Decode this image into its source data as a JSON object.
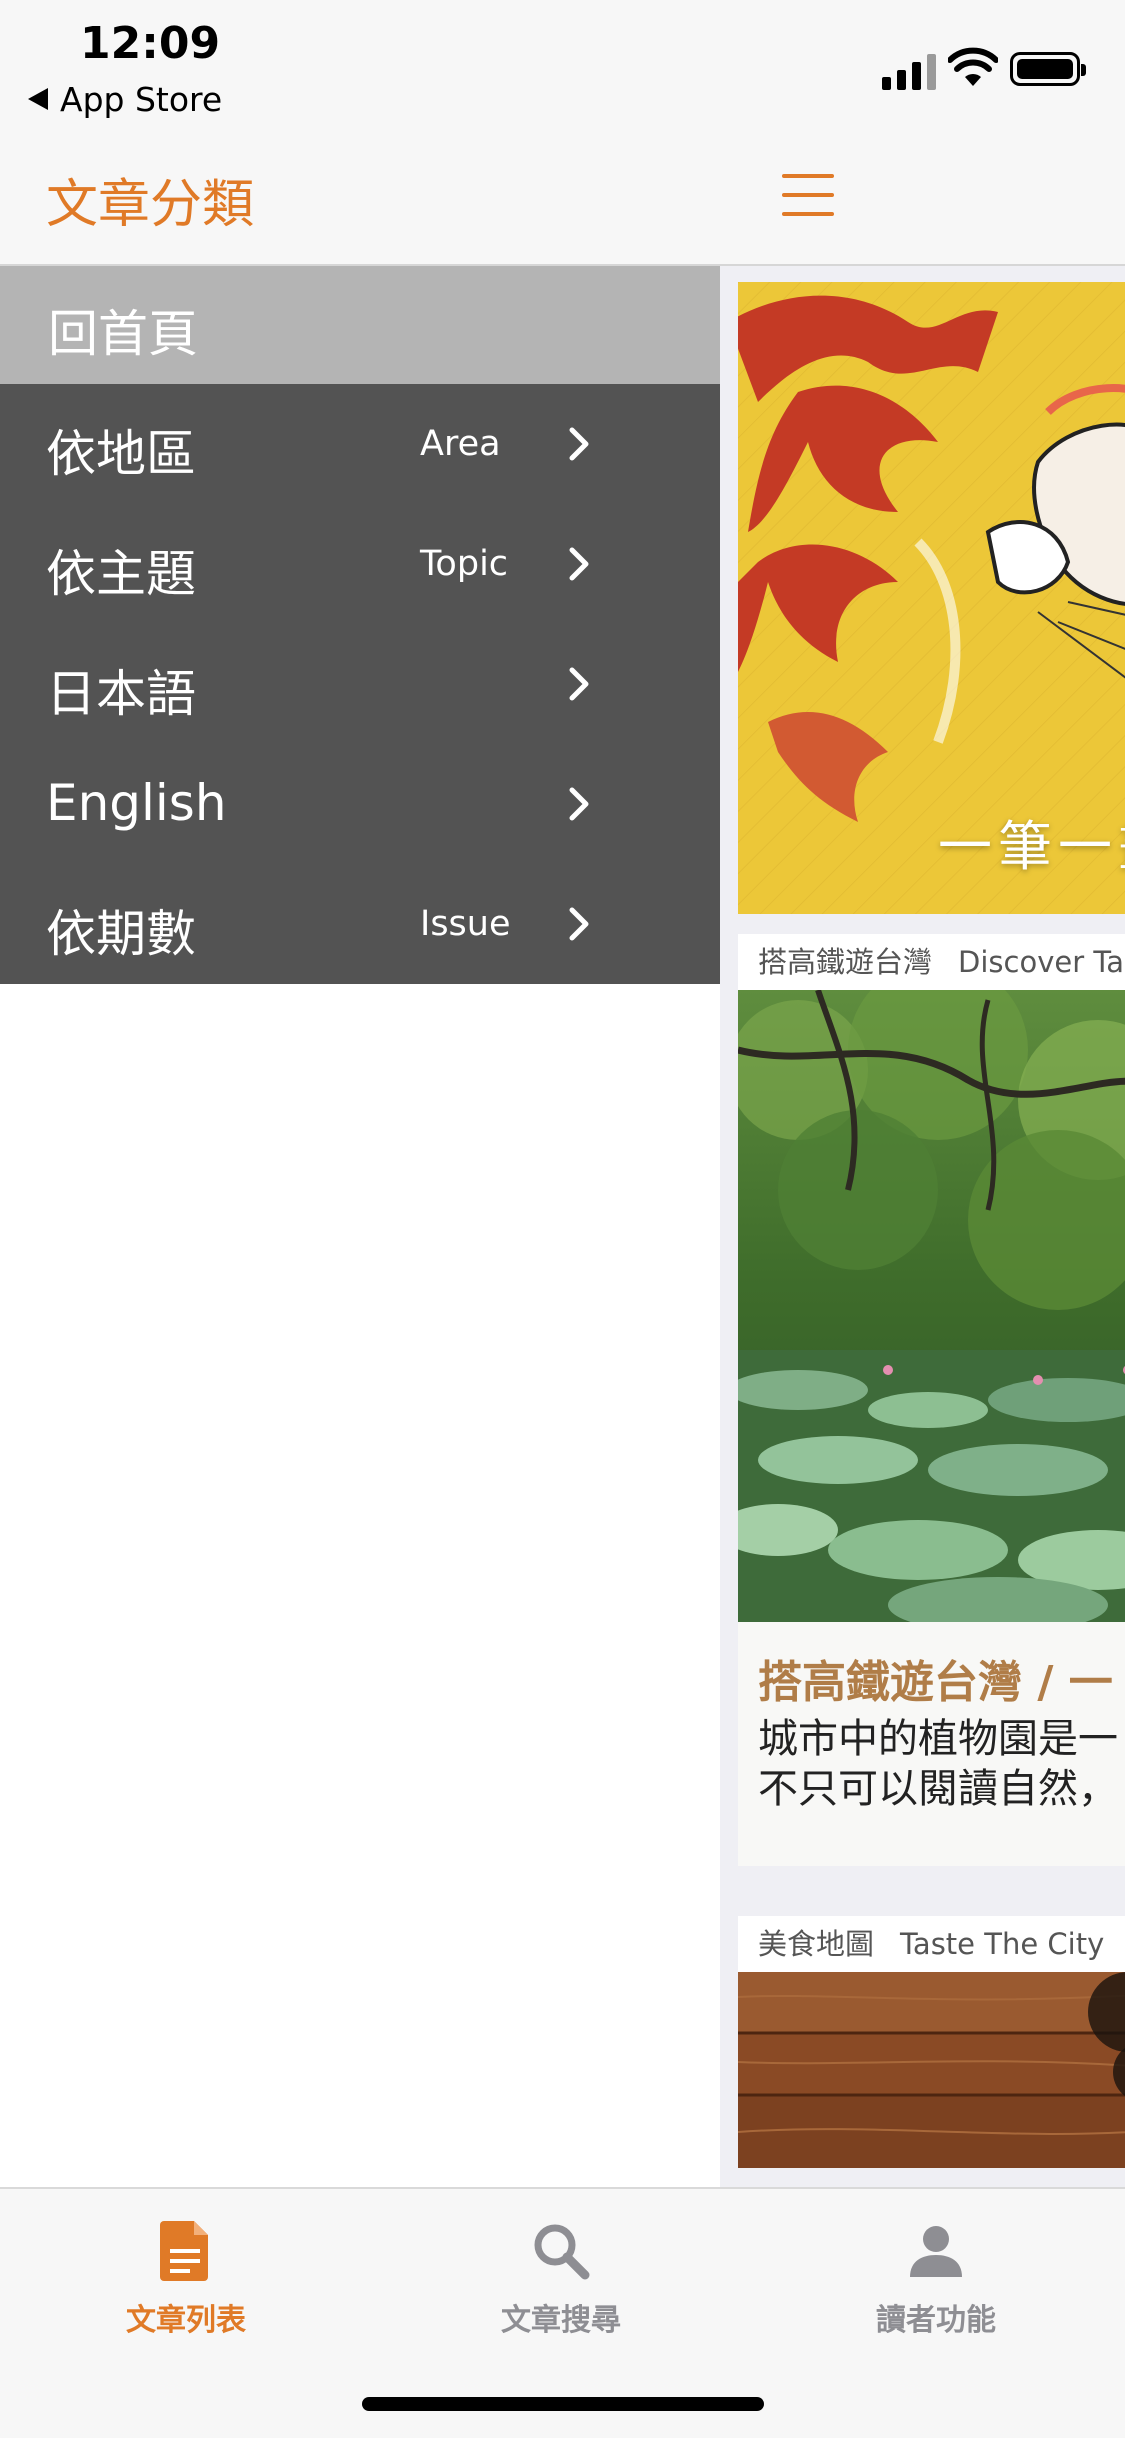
{
  "status_bar": {
    "time": "12:09",
    "back_label": "App Store"
  },
  "drawer": {
    "title": "文章分類",
    "home_item": "回首頁",
    "items": [
      {
        "label": "依地區",
        "sub": "Area"
      },
      {
        "label": "依主題",
        "sub": "Topic"
      },
      {
        "label": "日本語",
        "sub": ""
      },
      {
        "label": "English",
        "sub": ""
      },
      {
        "label": "依期數",
        "sub": "Issue"
      }
    ]
  },
  "content": {
    "hero_caption": "一筆一畫",
    "cards": [
      {
        "category": "搭高鐵遊台灣",
        "category_en": "Discover Ta",
        "title": "搭高鐵遊台灣 / 一",
        "desc_line1": "城市中的植物園是一",
        "desc_line2": "不只可以閱讀自然，"
      },
      {
        "category": "美食地圖",
        "category_en": "Taste The City"
      }
    ]
  },
  "tabbar": {
    "tabs": [
      {
        "label": "文章列表",
        "icon": "document-icon",
        "active": true
      },
      {
        "label": "文章搜尋",
        "icon": "search-icon",
        "active": false
      },
      {
        "label": "讀者功能",
        "icon": "person-icon",
        "active": false
      }
    ],
    "active_color": "#e07a27",
    "inactive_color": "#8e8e93"
  },
  "colors": {
    "accent": "#e07a27",
    "menu_bg": "#535353",
    "home_bg": "#b4b4b4"
  }
}
